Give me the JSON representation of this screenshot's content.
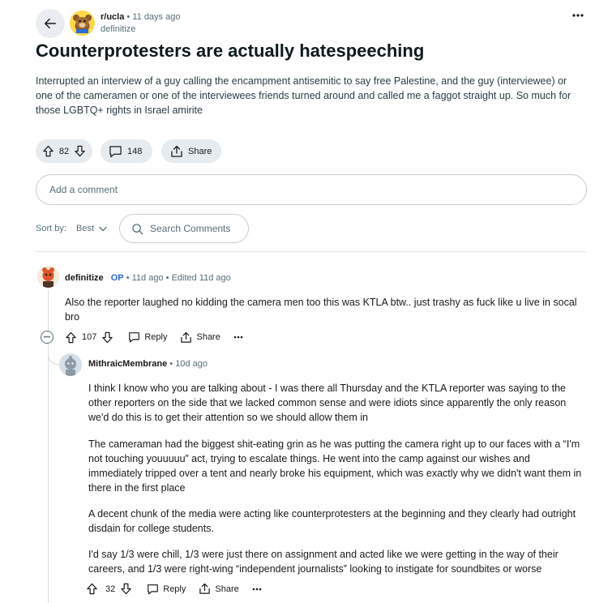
{
  "post": {
    "subreddit": "r/ucla",
    "age": "11 days ago",
    "author": "definitize",
    "title": "Counterprotesters are actually hatespeeching",
    "body": "Interrupted an interview of a guy calling the encampment antisemitic to say free Palestine, and the guy (interviewee) or one of the cameramen or one of the interviewees friends turned around and called me a faggot straight up. So much for those LGBTQ+ rights in Israel amirite",
    "score": "82",
    "comment_count": "148",
    "share_label": "Share"
  },
  "add_comment_placeholder": "Add a comment",
  "sort": {
    "label": "Sort by:",
    "value": "Best"
  },
  "search_comments_placeholder": "Search Comments",
  "comments": [
    {
      "author": "definitize",
      "op_badge": "OP",
      "age": "11d ago",
      "edited": "Edited 11d ago",
      "body": "Also the reporter laughed no kidding the camera men too this was KTLA btw.. just trashy as fuck like u live in socal bro",
      "score": "107",
      "reply_label": "Reply",
      "share_label": "Share"
    },
    {
      "author": "MithraicMembrane",
      "age": "10d ago",
      "paragraphs": [
        "I think I know who you are talking about - I was there all Thursday and the KTLA reporter was saying to the other reporters on the side that we lacked common sense and were idiots since apparently the only reason we'd do this is to get their attention so we should allow them in",
        "The cameraman had the biggest shit-eating grin as he was putting the camera right up to our faces with a “I'm not touching youuuuu” act, trying to escalate things. He went into the camp against our wishes and immediately tripped over a tent and nearly broke his equipment, which was exactly why we didn't want them in there in the first place",
        "A decent chunk of the media were acting like counterprotesters at the beginning and they clearly had outright disdain for college students.",
        "I'd say 1/3 were chill, 1/3 were just there on assignment and acted like we were getting in the way of their careers, and 1/3 were right-wing “independent journalists” looking to instigate for soundbites or worse"
      ],
      "score": "32",
      "reply_label": "Reply",
      "share_label": "Share"
    }
  ],
  "icons": {
    "back": "back-arrow-icon",
    "more": "more-dots-icon",
    "upvote": "upvote-icon",
    "downvote": "downvote-icon",
    "comment": "comment-bubble-icon",
    "share": "share-icon",
    "search": "search-icon",
    "collapse": "collapse-minus-icon",
    "chevron": "chevron-down-icon"
  },
  "colors": {
    "pill_bg": "#e5ebee",
    "meta_text": "#576f76",
    "op_badge": "#2a6bd6",
    "title_text": "#0f1a1c"
  }
}
